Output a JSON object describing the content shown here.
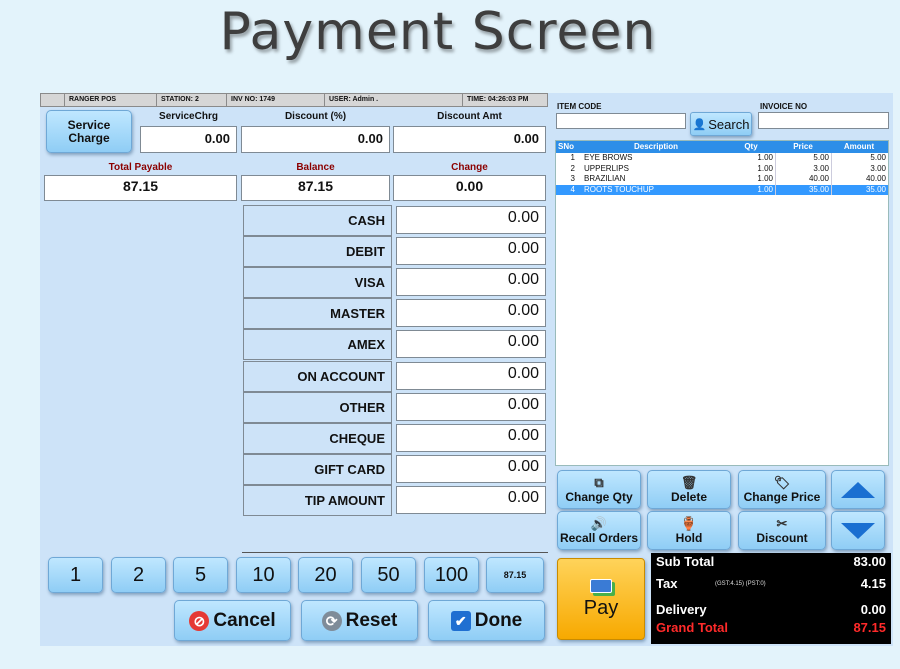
{
  "page": {
    "title": "Payment Screen"
  },
  "status": {
    "app": "RANGER POS",
    "station": "STATION: 2",
    "inv": "INV NO: 1749",
    "user": "USER: Admin .",
    "time": "TIME: 04:26:03 PM"
  },
  "service": {
    "button_label_1": "Service",
    "button_label_2": "Charge",
    "charge_label": "ServiceChrg",
    "charge_value": "0.00"
  },
  "discount": {
    "pct_label": "Discount (%)",
    "pct_value": "0.00",
    "amt_label": "Discount Amt",
    "amt_value": "0.00"
  },
  "summary": {
    "total_label": "Total  Payable",
    "total_value": "87.15",
    "balance_label": "Balance",
    "balance_value": "87.15",
    "change_label": "Change",
    "change_value": "0.00"
  },
  "payments": [
    {
      "label": "CASH",
      "value": "0.00"
    },
    {
      "label": "DEBIT",
      "value": "0.00"
    },
    {
      "label": "VISA",
      "value": "0.00"
    },
    {
      "label": "MASTER",
      "value": "0.00"
    },
    {
      "label": "AMEX",
      "value": "0.00"
    },
    {
      "label": "ON ACCOUNT",
      "value": "0.00"
    },
    {
      "label": "OTHER",
      "value": "0.00"
    },
    {
      "label": "CHEQUE",
      "value": "0.00"
    },
    {
      "label": "GIFT CARD",
      "value": "0.00"
    },
    {
      "label": "TIP AMOUNT",
      "value": "0.00"
    }
  ],
  "quick_amounts": [
    "1",
    "2",
    "5",
    "10",
    "20",
    "50",
    "100",
    "87.15"
  ],
  "actions": {
    "cancel": "Cancel",
    "reset": "Reset",
    "done": "Done"
  },
  "lookup": {
    "item_code_label": "ITEM CODE",
    "item_code_value": "",
    "search_label": "Search",
    "invoice_label": "INVOICE NO",
    "invoice_value": ""
  },
  "table": {
    "headers": {
      "sno": "SNo",
      "desc": "Description",
      "qty": "Qty",
      "price": "Price",
      "amount": "Amount"
    },
    "rows": [
      {
        "sno": "1",
        "desc": "EYE BROWS",
        "qty": "1.00",
        "price": "5.00",
        "amount": "5.00"
      },
      {
        "sno": "2",
        "desc": "UPPERLIPS",
        "qty": "1.00",
        "price": "3.00",
        "amount": "3.00"
      },
      {
        "sno": "3",
        "desc": "BRAZILIAN",
        "qty": "1.00",
        "price": "40.00",
        "amount": "40.00"
      },
      {
        "sno": "4",
        "desc": "ROOTS TOUCHUP",
        "qty": "1.00",
        "price": "35.00",
        "amount": "35.00"
      }
    ],
    "selected_row": 4
  },
  "functions": {
    "change_qty": "Change Qty",
    "delete": "Delete",
    "change_price": "Change Price",
    "recall_orders": "Recall Orders",
    "hold": "Hold",
    "discount": "Discount"
  },
  "pay": {
    "label": "Pay"
  },
  "totals": {
    "subtotal_label": "Sub Total",
    "subtotal": "83.00",
    "tax_label": "Tax",
    "tax_detail": "(GST:4.15)  (PST:0)",
    "tax": "4.15",
    "delivery_label": "Delivery",
    "delivery": "0.00",
    "grand_label": "Grand Total",
    "grand": "87.15"
  },
  "colors": {
    "accent": "#2d8ee8",
    "pay_button": "#f7a900",
    "grand_total": "#ff2a2a",
    "background": "#cde3f8"
  }
}
